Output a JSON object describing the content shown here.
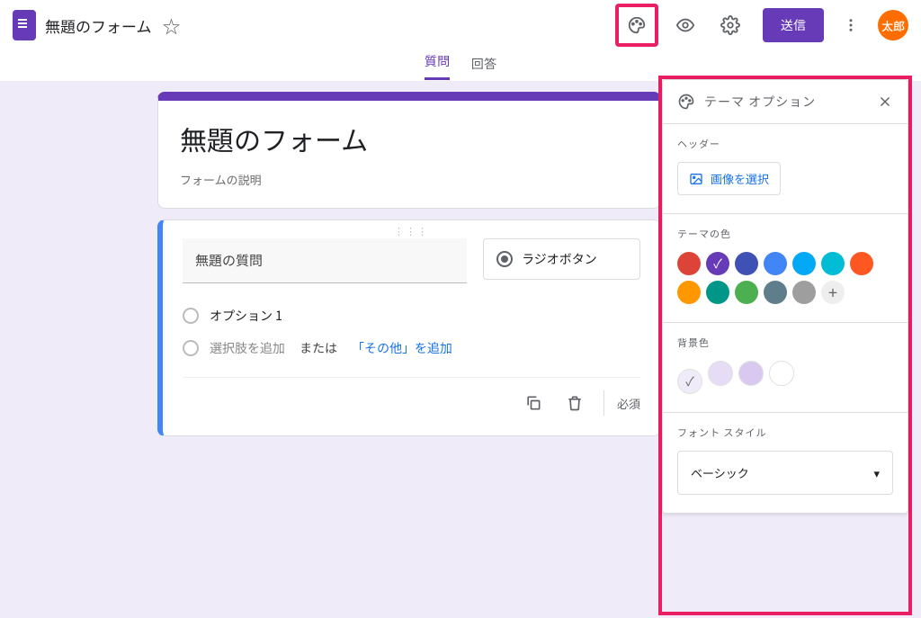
{
  "header": {
    "doc_title": "無題のフォーム",
    "send_label": "送信",
    "avatar_text": "太郎"
  },
  "tabs": {
    "questions": "質問",
    "responses": "回答"
  },
  "form": {
    "title": "無題のフォーム",
    "description": "フォームの説明"
  },
  "question": {
    "title": "無題の質問",
    "type_label": "ラジオボタン",
    "option1": "オプション 1",
    "add_option": "選択肢を追加",
    "or": "または",
    "add_other": "「その他」を追加",
    "required_label": "必須"
  },
  "theme": {
    "panel_title": "テーマ オプション",
    "header_label": "ヘッダー",
    "choose_image": "画像を選択",
    "color_label": "テーマの色",
    "bg_label": "背景色",
    "font_label": "フォント スタイル",
    "font_value": "ベーシック",
    "colors": [
      "#db4437",
      "#673ab7",
      "#3f51b5",
      "#4285f4",
      "#03a9f4",
      "#00bcd4",
      "#ff5722",
      "#ff9800",
      "#009688",
      "#4caf50",
      "#607d8b",
      "#9e9e9e"
    ],
    "selected_color_index": 1,
    "bg_colors": [
      "#f0ebf8",
      "#e6dcf5",
      "#d9c9f0",
      "#ffffff"
    ],
    "selected_bg_index": 0
  }
}
